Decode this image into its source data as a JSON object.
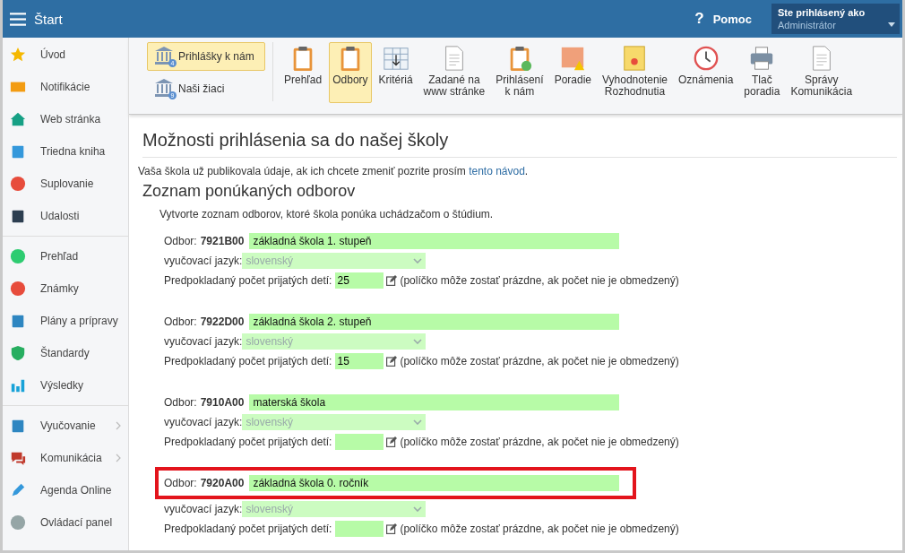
{
  "topbar": {
    "title": "Štart",
    "help": "?",
    "help_label": "Pomoc",
    "user": {
      "caption": "Ste prihlásený ako",
      "name": "Administrátor"
    }
  },
  "sidebar": {
    "groups": [
      {
        "items": [
          {
            "label": "Úvod",
            "submenu": false
          },
          {
            "label": "Notifikácie",
            "submenu": false
          },
          {
            "label": "Web stránka",
            "submenu": false
          },
          {
            "label": "Triedna kniha",
            "submenu": false
          },
          {
            "label": "Suplovanie",
            "submenu": false
          },
          {
            "label": "Udalosti",
            "submenu": false
          }
        ]
      },
      {
        "items": [
          {
            "label": "Prehľad",
            "submenu": false
          },
          {
            "label": "Známky",
            "submenu": false
          },
          {
            "label": "Plány a prípravy",
            "submenu": false
          },
          {
            "label": "Štandardy",
            "submenu": false
          },
          {
            "label": "Výsledky",
            "submenu": false
          }
        ]
      },
      {
        "items": [
          {
            "label": "Vyučovanie",
            "submenu": true
          },
          {
            "label": "Komunikácia",
            "submenu": true
          },
          {
            "label": "Agenda Online",
            "submenu": false
          },
          {
            "label": "Ovládací panel",
            "submenu": false
          }
        ]
      }
    ]
  },
  "toolbar": {
    "side_buttons": [
      {
        "label": "Prihlášky k nám",
        "badge": "4",
        "selected": true
      },
      {
        "label": "Naši žiaci",
        "badge": "9",
        "selected": false
      }
    ],
    "buttons": [
      {
        "label": "Prehľad",
        "selected": false
      },
      {
        "label": "Odbory",
        "selected": true
      },
      {
        "label": "Kritériá",
        "selected": false
      },
      {
        "label": "Zadané na\nwww stránke",
        "selected": false
      },
      {
        "label": "Prihlásení\nk nám",
        "selected": false
      },
      {
        "label": "Poradie",
        "selected": false
      },
      {
        "label": "Vyhodnotenie\nRozhodnutia",
        "selected": false
      },
      {
        "label": "Oznámenia",
        "selected": false
      },
      {
        "label": "Tlač\nporadia",
        "selected": false
      },
      {
        "label": "Správy\nKomunikácia",
        "selected": false
      }
    ]
  },
  "page": {
    "title": "Možnosti prihlásenia sa do našej školy",
    "notice": "Vaša škola už publikovala údaje, ak ich chcete zmeniť pozrite prosím",
    "notice_link": "tento návod",
    "notice_end": ".",
    "section_title": "Zoznam ponúkaných odborov",
    "section_text": "Vytvorte zoznam odborov, ktoré škola ponúka uchádzačom o štúdium.",
    "odbory": [
      {
        "label": "Odbor:",
        "code": "7921B00",
        "name": "základná škola 1. stupeň",
        "language_label": "vyučovací jazyk:",
        "language": "slovenský",
        "count_label": "Predpokladaný počet prijatých detí:",
        "count": "25",
        "hint": "(políčko môže zostať prázdne, ak počet nie je obmedzený)",
        "highlighted": false
      },
      {
        "label": "Odbor:",
        "code": "7922D00",
        "name": "základná škola 2. stupeň",
        "language_label": "vyučovací jazyk:",
        "language": "slovenský",
        "count_label": "Predpokladaný počet prijatých detí:",
        "count": "15",
        "hint": "(políčko môže zostať prázdne, ak počet nie je obmedzený)",
        "highlighted": false
      },
      {
        "label": "Odbor:",
        "code": "7910A00",
        "name": "materská škola",
        "language_label": "vyučovací jazyk:",
        "language": "slovenský",
        "count_label": "Predpokladaný počet prijatých detí:",
        "hint": "(políčko môže zostať prázdne, ak počet nie je obmedzený)",
        "highlighted": false
      },
      {
        "label": "Odbor:",
        "code": "7920A00",
        "name": "základná škola 0. ročník",
        "language_label": "vyučovací jazyk:",
        "language": "slovenský",
        "count_label": "Predpokladaný počet prijatých detí:",
        "hint": "(políčko môže zostať prázdne, ak počet nie je obmedzený)",
        "highlighted": true
      }
    ]
  }
}
